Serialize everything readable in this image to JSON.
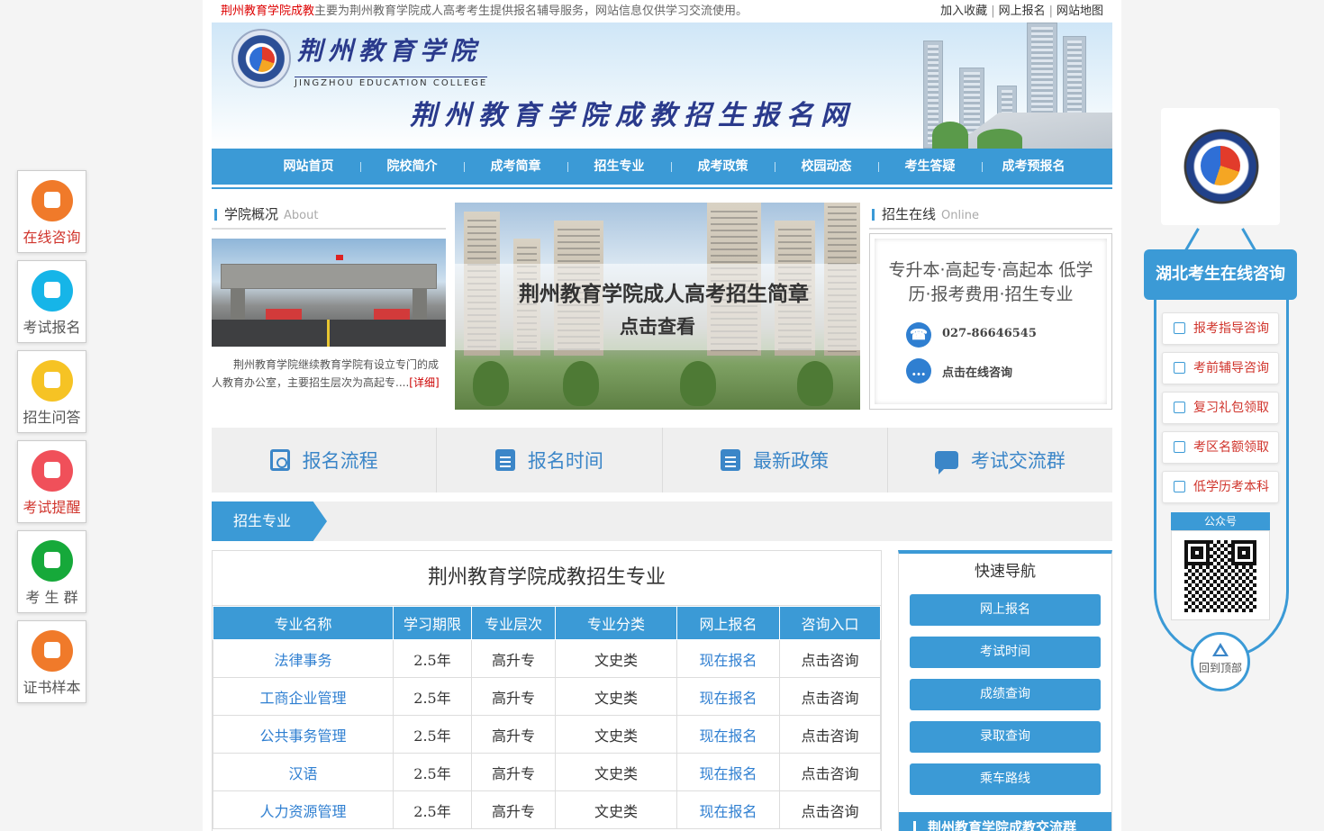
{
  "topbar": {
    "brand": "荆州教育学院成教",
    "notice": "主要为荆州教育学院成人高考考生提供报名辅导服务，网站信息仅供学习交流使用。",
    "links": [
      "加入收藏",
      "网上报名",
      "网站地图"
    ]
  },
  "banner": {
    "school_name": "荆州教育学院",
    "school_name_en": "JINGZHOU EDUCATION COLLEGE",
    "site_title": "荆州教育学院成教招生报名网"
  },
  "nav": [
    "网站首页",
    "院校简介",
    "成考简章",
    "招生专业",
    "成考政策",
    "校园动态",
    "考生答疑",
    "成考预报名"
  ],
  "about": {
    "title": "学院概况",
    "title_en": "About",
    "text": "荆州教育学院继续教育学院有设立专门的成人教育办公室，主要招生层次为高起专....",
    "more": "[详细]"
  },
  "slide": {
    "headline": "荆州教育学院成人高考招生简章",
    "cta": "点击查看"
  },
  "online": {
    "title": "招生在线",
    "title_en": "Online",
    "desc": "专升本·高起专·高起本 低学历·报考费用·招生专业",
    "phone": "027-86646545",
    "consult": "点击在线咨询"
  },
  "quick": [
    {
      "label": "报名流程",
      "icon": "search-doc-icon"
    },
    {
      "label": "报名时间",
      "icon": "book-icon"
    },
    {
      "label": "最新政策",
      "icon": "document-icon"
    },
    {
      "label": "考试交流群",
      "icon": "chat-icon"
    }
  ],
  "majors": {
    "tab": "招生专业",
    "table_title": "荆州教育学院成教招生专业",
    "headers": [
      "专业名称",
      "学习期限",
      "专业层次",
      "专业分类",
      "网上报名",
      "咨询入口"
    ],
    "rows": [
      [
        "法律事务",
        "2.5年",
        "高升专",
        "文史类",
        "现在报名",
        "点击咨询"
      ],
      [
        "工商企业管理",
        "2.5年",
        "高升专",
        "文史类",
        "现在报名",
        "点击咨询"
      ],
      [
        "公共事务管理",
        "2.5年",
        "高升专",
        "文史类",
        "现在报名",
        "点击咨询"
      ],
      [
        "汉语",
        "2.5年",
        "高升专",
        "文史类",
        "现在报名",
        "点击咨询"
      ],
      [
        "人力资源管理",
        "2.5年",
        "高升专",
        "文史类",
        "现在报名",
        "点击咨询"
      ]
    ]
  },
  "quicknav": {
    "title": "快速导航",
    "items": [
      "网上报名",
      "考试时间",
      "成绩查询",
      "录取查询",
      "乘车路线"
    ],
    "group": "荆州教育学院成教交流群"
  },
  "left_float": [
    {
      "label": "在线咨询",
      "color": "#f07a2a",
      "highlight": true
    },
    {
      "label": "考试报名",
      "color": "#16b5e8",
      "highlight": false
    },
    {
      "label": "招生问答",
      "color": "#f6c324",
      "highlight": false
    },
    {
      "label": "考试提醒",
      "color": "#f0505a",
      "highlight": true
    },
    {
      "label": "考 生 群",
      "color": "#16a93a",
      "highlight": false
    },
    {
      "label": "证书样本",
      "color": "#f07a2a",
      "highlight": false
    }
  ],
  "right_float": {
    "title": "湖北考生在线咨询",
    "items": [
      "报考指导咨询",
      "考前辅导咨询",
      "复习礼包领取",
      "考区名额领取",
      "低学历考本科"
    ],
    "qr_label": "公众号",
    "back_top": "回到顶部"
  }
}
